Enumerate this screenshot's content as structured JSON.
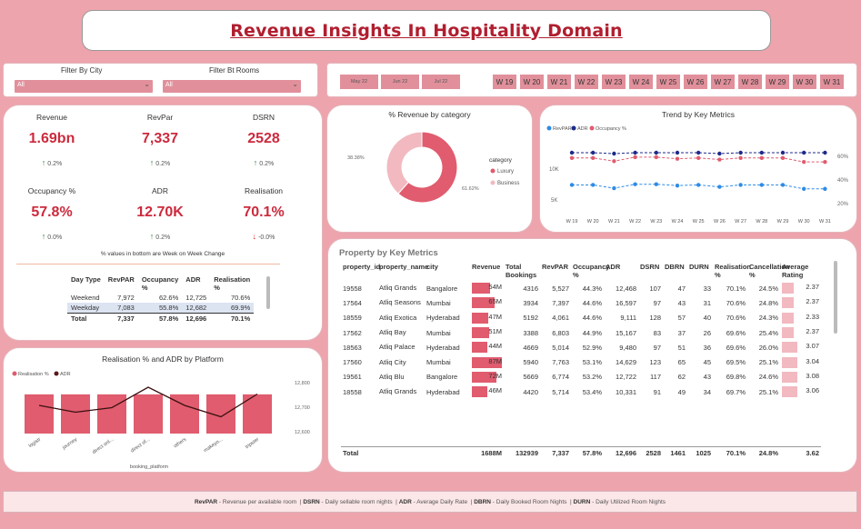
{
  "title": "Revenue Insights In Hospitality Domain",
  "filters": {
    "city_label": "Filter By City",
    "city_value": "All",
    "rooms_label": "Filter Bt Rooms",
    "rooms_value": "All"
  },
  "months": [
    "May 22",
    "Jun 22",
    "Jul 22"
  ],
  "weeks": [
    "W 19",
    "W 20",
    "W 21",
    "W 22",
    "W 23",
    "W 24",
    "W 25",
    "W 26",
    "W 27",
    "W 28",
    "W 29",
    "W 30",
    "W 31"
  ],
  "kpis": [
    {
      "label": "Revenue",
      "value": "1.69bn",
      "change": "0.2%",
      "dir": "up"
    },
    {
      "label": "RevPar",
      "value": "7,337",
      "change": "0.2%",
      "dir": "up"
    },
    {
      "label": "DSRN",
      "value": "2528",
      "change": "0.2%",
      "dir": "up"
    },
    {
      "label": "Occupancy %",
      "value": "57.8%",
      "change": "0.0%",
      "dir": "up"
    },
    {
      "label": "ADR",
      "value": "12.70K",
      "change": "0.2%",
      "dir": "up"
    },
    {
      "label": "Realisation",
      "value": "70.1%",
      "change": "-0.0%",
      "dir": "down"
    }
  ],
  "kpi_note": "% values in bottom are Week on Week Change",
  "daytype": {
    "headers": [
      "Day Type",
      "RevPAR",
      "Occupancy %",
      "ADR",
      "Realisation %"
    ],
    "rows": [
      [
        "Weekend",
        "7,972",
        "62.6%",
        "12,725",
        "70.6%"
      ],
      [
        "Weekday",
        "7,083",
        "55.8%",
        "12,682",
        "69.9%"
      ]
    ],
    "total": [
      "Total",
      "7,337",
      "57.8%",
      "12,696",
      "70.1%"
    ]
  },
  "platform_chart": {
    "title": "Realisation % and ADR by Platform",
    "legend": [
      "Realisation %",
      "ADR"
    ],
    "xlabel": "booking_platform",
    "categories": [
      "logistr",
      "journey",
      "direct onl...",
      "direct of...",
      "others",
      "makeyo...",
      "tripster"
    ],
    "realisation": [
      70.1,
      70.1,
      70.1,
      70.1,
      70.1,
      70.1,
      70.1
    ],
    "adr": [
      12690,
      12660,
      12680,
      12770,
      12690,
      12640,
      12740
    ],
    "y_ticks": [
      "12,800",
      "12,700",
      "12,600"
    ]
  },
  "donut_chart": {
    "title": "% Revenue by category",
    "legend_title": "category",
    "slices": [
      {
        "name": "Luxury",
        "value": 61.62,
        "label": "61.62%",
        "color": "#e05c6e"
      },
      {
        "name": "Business",
        "value": 38.38,
        "label": "38.38%",
        "color": "#f2b9c0"
      }
    ]
  },
  "trend_chart": {
    "title": "Trend by Key Metrics",
    "legend": [
      "RevPAR",
      "ADR",
      "Occupancy %"
    ],
    "x": [
      "W 19",
      "W 20",
      "W 21",
      "W 22",
      "W 23",
      "W 24",
      "W 25",
      "W 26",
      "W 27",
      "W 28",
      "W 29",
      "W 30",
      "W 31"
    ],
    "left_ticks": [
      "10K",
      "5K"
    ],
    "right_ticks": [
      "60%",
      "40%",
      "20%"
    ],
    "revpar": [
      7300,
      7300,
      6800,
      7400,
      7400,
      7200,
      7300,
      7000,
      7300,
      7300,
      7300,
      6700,
      6700
    ],
    "adr": [
      12700,
      12700,
      12600,
      12700,
      12700,
      12700,
      12700,
      12600,
      12700,
      12700,
      12700,
      12700,
      12700
    ],
    "occupancy": [
      58,
      58,
      54,
      59,
      59,
      57,
      58,
      56,
      58,
      58,
      58,
      53,
      53
    ]
  },
  "property_table": {
    "title": "Property by Key Metrics",
    "headers": [
      "property_id",
      "property_name",
      "city",
      "Revenue",
      "Total Bookings",
      "RevPAR",
      "Occupancy %",
      "ADR",
      "DSRN",
      "DBRN",
      "DURN",
      "Realisation %",
      "Cancellation %",
      "Average Rating"
    ],
    "rows": [
      {
        "id": "19558",
        "name": "Atliq Grands",
        "city": "Bangalore",
        "revenue": "54M",
        "rev_num": 54,
        "bookings": "4316",
        "revpar": "5,527",
        "occ": "44.3%",
        "adr": "12,468",
        "dsrn": "107",
        "dbrn": "47",
        "durn": "33",
        "real": "70.1%",
        "cancel": "24.5%",
        "rating": "2.37",
        "rating_num": 2.37
      },
      {
        "id": "17564",
        "name": "Atliq Seasons",
        "city": "Mumbai",
        "revenue": "65M",
        "rev_num": 65,
        "bookings": "3934",
        "revpar": "7,397",
        "occ": "44.6%",
        "adr": "16,597",
        "dsrn": "97",
        "dbrn": "43",
        "durn": "31",
        "real": "70.6%",
        "cancel": "24.8%",
        "rating": "2.37",
        "rating_num": 2.37
      },
      {
        "id": "18559",
        "name": "Atliq Exotica",
        "city": "Hyderabad",
        "revenue": "47M",
        "rev_num": 47,
        "bookings": "5192",
        "revpar": "4,061",
        "occ": "44.6%",
        "adr": "9,111",
        "dsrn": "128",
        "dbrn": "57",
        "durn": "40",
        "real": "70.6%",
        "cancel": "24.3%",
        "rating": "2.33",
        "rating_num": 2.33
      },
      {
        "id": "17562",
        "name": "Atliq Bay",
        "city": "Mumbai",
        "revenue": "51M",
        "rev_num": 51,
        "bookings": "3388",
        "revpar": "6,803",
        "occ": "44.9%",
        "adr": "15,167",
        "dsrn": "83",
        "dbrn": "37",
        "durn": "26",
        "real": "69.6%",
        "cancel": "25.4%",
        "rating": "2.37",
        "rating_num": 2.37
      },
      {
        "id": "18563",
        "name": "Atliq Palace",
        "city": "Hyderabad",
        "revenue": "44M",
        "rev_num": 44,
        "bookings": "4669",
        "revpar": "5,014",
        "occ": "52.9%",
        "adr": "9,480",
        "dsrn": "97",
        "dbrn": "51",
        "durn": "36",
        "real": "69.6%",
        "cancel": "26.0%",
        "rating": "3.07",
        "rating_num": 3.07
      },
      {
        "id": "17560",
        "name": "Atliq City",
        "city": "Mumbai",
        "revenue": "87M",
        "rev_num": 87,
        "bookings": "5940",
        "revpar": "7,763",
        "occ": "53.1%",
        "adr": "14,629",
        "dsrn": "123",
        "dbrn": "65",
        "durn": "45",
        "real": "69.5%",
        "cancel": "25.1%",
        "rating": "3.04",
        "rating_num": 3.04
      },
      {
        "id": "19561",
        "name": "Atliq Blu",
        "city": "Bangalore",
        "revenue": "72M",
        "rev_num": 72,
        "bookings": "5669",
        "revpar": "6,774",
        "occ": "53.2%",
        "adr": "12,722",
        "dsrn": "117",
        "dbrn": "62",
        "durn": "43",
        "real": "69.8%",
        "cancel": "24.6%",
        "rating": "3.08",
        "rating_num": 3.08
      },
      {
        "id": "18558",
        "name": "Atliq Grands",
        "city": "Hyderabad",
        "revenue": "46M",
        "rev_num": 46,
        "bookings": "4420",
        "revpar": "5,714",
        "occ": "53.4%",
        "adr": "10,331",
        "dsrn": "91",
        "dbrn": "49",
        "durn": "34",
        "real": "69.7%",
        "cancel": "25.1%",
        "rating": "3.06",
        "rating_num": 3.06
      }
    ],
    "total": {
      "label": "Total",
      "revenue": "1688M",
      "bookings": "132939",
      "revpar": "7,337",
      "occ": "57.8%",
      "adr": "12,696",
      "dsrn": "2528",
      "dbrn": "1461",
      "durn": "1025",
      "real": "70.1%",
      "cancel": "24.8%",
      "rating": "3.62"
    }
  },
  "footer": [
    {
      "abbr": "RevPAR",
      "desc": " - Revenue per available room | "
    },
    {
      "abbr": "DSRN",
      "desc": " - Daily sellable room nights | "
    },
    {
      "abbr": "ADR",
      "desc": " - Average Daily Rate | "
    },
    {
      "abbr": "DBRN",
      "desc": " - Daily Booked Room Nights | "
    },
    {
      "abbr": "DURN",
      "desc": " - Daily Utilized Room Nights"
    }
  ]
}
